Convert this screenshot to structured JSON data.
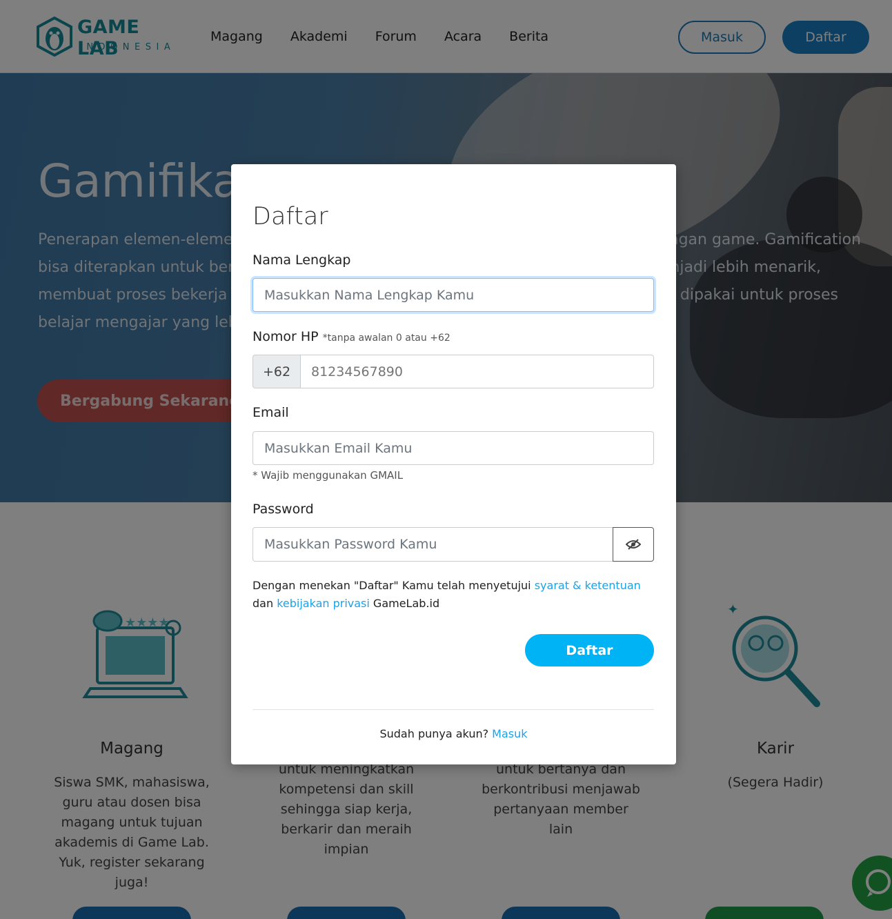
{
  "header": {
    "logo_title": "GAME LAB",
    "logo_sub": "INDONESIA",
    "nav": [
      "Magang",
      "Akademi",
      "Forum",
      "Acara",
      "Berita"
    ],
    "login_label": "Masuk",
    "register_label": "Daftar"
  },
  "hero": {
    "title": "Gamifika",
    "line1_left": "Penerapan elemen-eleme",
    "line1_right": "ngan game. Gamification",
    "line2_left": "bisa diterapkan untuk ber",
    "line2_right": "njadi lebih menarik,",
    "line3_left": "membuat proses bekerja",
    "line3_right": "dipakai untuk proses",
    "line4_left": "belajar mengajar yang leb",
    "cta_label": "Bergabung Sekarang"
  },
  "features": [
    {
      "title": "Magang",
      "desc": "Siswa SMK, mahasiswa, guru atau dosen bisa magang untuk tujuan akademis di Game Lab. Yuk, register sekarang juga!"
    },
    {
      "title": "",
      "desc": "Program pelatihan untuk meningkatkan kompetensi dan skill sehingga siap kerja, berkarir dan meraih impian"
    },
    {
      "title": "",
      "desc": "Gunakan fitur Forum untuk bertanya dan berkontribusi menjawab pertanyaan member lain"
    },
    {
      "title": "Karir",
      "desc": "(Segera Hadir)"
    }
  ],
  "modal": {
    "title": "Daftar",
    "name_label": "Nama Lengkap",
    "name_placeholder": "Masukkan Nama Lengkap Kamu",
    "phone_label": "Nomor HP",
    "phone_note": "*tanpa awalan 0 atau +62",
    "phone_prefix": "+62",
    "phone_placeholder": "81234567890",
    "email_label": "Email",
    "email_placeholder": "Masukkan Email Kamu",
    "email_hint": "* Wajib menggunakan GMAIL",
    "password_label": "Password",
    "password_placeholder": "Masukkan Password Kamu",
    "terms_pre": "Dengan menekan \"Daftar\" Kamu telah menyetujui ",
    "terms_link": "syarat & ketentuan",
    "terms_mid": "dan ",
    "privacy_link": "kebijakan privasi",
    "terms_post": " GameLab.id",
    "submit_label": "Daftar",
    "footer_text": "Sudah punya akun? ",
    "footer_link": "Masuk"
  },
  "colors": {
    "brand_teal": "#178a99",
    "primary_blue": "#1a7fc4",
    "submit_cyan": "#00b3f5",
    "link": "#1aa3e8"
  }
}
